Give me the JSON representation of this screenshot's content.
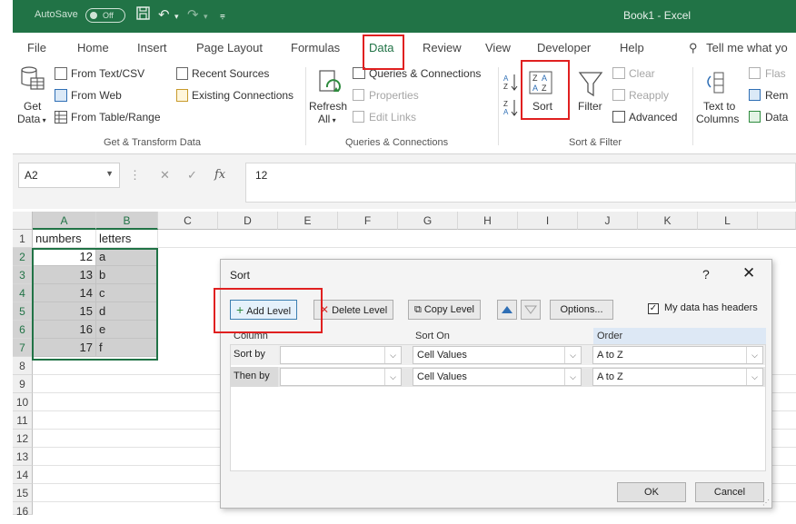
{
  "titlebar": {
    "autosave_label": "AutoSave",
    "autosave_state": "Off",
    "window_title": "Book1 - Excel"
  },
  "tabs": [
    "File",
    "Home",
    "Insert",
    "Page Layout",
    "Formulas",
    "Data",
    "Review",
    "View",
    "Developer",
    "Help"
  ],
  "active_tab": "Data",
  "tell_me": "Tell me what yo",
  "ribbon": {
    "get_transform": {
      "get_data_line1": "Get",
      "get_data_line2": "Data",
      "from_text_csv": "From Text/CSV",
      "from_web": "From Web",
      "from_table_range": "From Table/Range",
      "recent_sources": "Recent Sources",
      "existing_connections": "Existing Connections",
      "group_label": "Get & Transform Data"
    },
    "queries": {
      "refresh_line1": "Refresh",
      "refresh_line2": "All",
      "queries_connections": "Queries & Connections",
      "properties": "Properties",
      "edit_links": "Edit Links",
      "group_label": "Queries & Connections"
    },
    "sort_filter": {
      "sort": "Sort",
      "filter": "Filter",
      "clear": "Clear",
      "reapply": "Reapply",
      "advanced": "Advanced",
      "group_label": "Sort & Filter"
    },
    "data_tools": {
      "text_to_line1": "Text to",
      "text_to_line2": "Columns",
      "flash": "Flas",
      "remove": "Rem",
      "data": "Data"
    }
  },
  "formula_bar": {
    "name_box": "A2",
    "fx": "fx",
    "value": "12"
  },
  "grid": {
    "columns": [
      "A",
      "B",
      "C",
      "D",
      "E",
      "F",
      "G",
      "H",
      "I",
      "J",
      "K",
      "L"
    ],
    "row_numbers": [
      "1",
      "2",
      "3",
      "4",
      "5",
      "6",
      "7",
      "8",
      "9",
      "10",
      "11",
      "12",
      "13",
      "14",
      "15",
      "16"
    ],
    "header_row": [
      "numbers",
      "letters"
    ],
    "data_rows": [
      [
        "12",
        "a"
      ],
      [
        "13",
        "b"
      ],
      [
        "14",
        "c"
      ],
      [
        "15",
        "d"
      ],
      [
        "16",
        "e"
      ],
      [
        "17",
        "f"
      ]
    ]
  },
  "sort_dialog": {
    "title": "Sort",
    "help": "?",
    "close": "✕",
    "add_level": "Add Level",
    "delete_level": "Delete Level",
    "copy_level": "Copy Level",
    "options": "Options...",
    "my_data_has_headers": "My data has headers",
    "headers_checked": true,
    "col_header_column": "Column",
    "col_header_sort_on": "Sort On",
    "col_header_order": "Order",
    "levels": [
      {
        "label": "Sort by",
        "column": "",
        "sort_on": "Cell Values",
        "order": "A to Z"
      },
      {
        "label": "Then by",
        "column": "",
        "sort_on": "Cell Values",
        "order": "A to Z"
      }
    ],
    "ok": "OK",
    "cancel": "Cancel"
  },
  "colors": {
    "excel_green": "#217346",
    "highlight_red": "#e02020"
  }
}
